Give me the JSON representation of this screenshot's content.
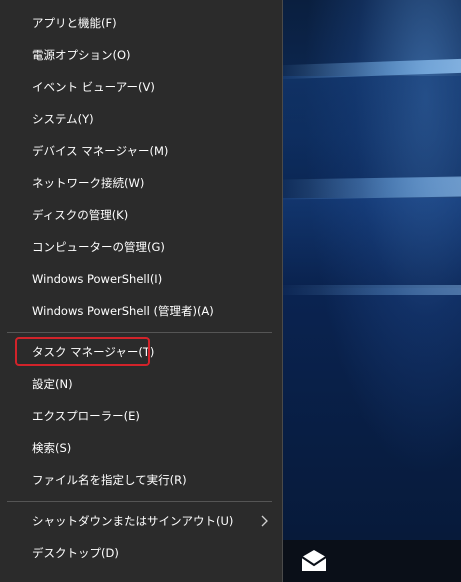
{
  "menu": {
    "items": [
      {
        "label": "アプリと機能(F)"
      },
      {
        "label": "電源オプション(O)"
      },
      {
        "label": "イベント ビューアー(V)"
      },
      {
        "label": "システム(Y)"
      },
      {
        "label": "デバイス マネージャー(M)"
      },
      {
        "label": "ネットワーク接続(W)"
      },
      {
        "label": "ディスクの管理(K)"
      },
      {
        "label": "コンピューターの管理(G)"
      },
      {
        "label": "Windows PowerShell(I)"
      },
      {
        "label": "Windows PowerShell (管理者)(A)"
      },
      {
        "label": "タスク マネージャー(T)"
      },
      {
        "label": "設定(N)"
      },
      {
        "label": "エクスプローラー(E)"
      },
      {
        "label": "検索(S)"
      },
      {
        "label": "ファイル名を指定して実行(R)"
      },
      {
        "label": "シャットダウンまたはサインアウト(U)",
        "submenu": true
      },
      {
        "label": "デスクトップ(D)"
      }
    ]
  },
  "highlight_color": "#d2232a",
  "taskbar": {
    "icons": [
      "mail-icon"
    ]
  }
}
